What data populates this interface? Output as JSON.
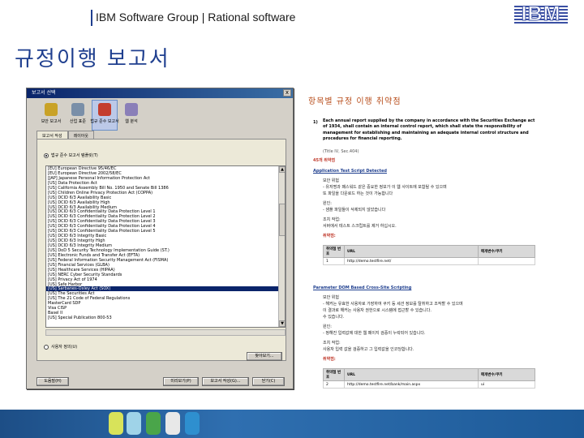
{
  "header": {
    "text": "IBM Software Group | Rational software",
    "logo": "IBM"
  },
  "slide_title": "규정이행 보고서",
  "colors": {
    "brand_blue": "#1f3f8f",
    "report_title": "#b84e1c",
    "selection": "#0a246a",
    "band": "#2f6fb0"
  },
  "dialog": {
    "title": "보고서 선택",
    "close_label": "x",
    "toolbar": [
      {
        "label": "보안 보고서",
        "icon": "lock-icon",
        "color": "#c9a227"
      },
      {
        "label": "산업 표준",
        "icon": "gear-icon",
        "color": "#7a8fa8"
      },
      {
        "label": "법규 준수 보고서",
        "icon": "compliance-icon",
        "color": "#c43d2e"
      },
      {
        "label": "웹 분석",
        "icon": "web-analysis-icon",
        "color": "#8a7fb8"
      }
    ],
    "tabs": [
      "보고서 작성",
      "레이아웃"
    ],
    "radio_top": "법규 준수 보고서 템플릿(T)",
    "list": [
      "[EU] European Directive 95/46/EC",
      "[EU] European Directive 2002/58/EC",
      "[JAP] Japanese Personal Information Protection Act",
      "[US] Data Protection Act",
      "[US] California Assembly Bill No. 1950 and Senate Bill 1386",
      "[US] Children Online Privacy Protection Act (COPPA)",
      "[US] DCID 6/3 Availability Basic",
      "[US] DCID 6/3 Availability High",
      "[US] DCID 6/3 Availability Medium",
      "[US] DCID 6/3 Confidentiality Data Protection Level 1",
      "[US] DCID 6/3 Confidentiality Data Protection Level 2",
      "[US] DCID 6/3 Confidentiality Data Protection Level 3",
      "[US] DCID 6/3 Confidentiality Data Protection Level 4",
      "[US] DCID 6/3 Confidentiality Data Protection Level 5",
      "[US] DCID 6/3 Integrity Basic",
      "[US] DCID 6/3 Integrity High",
      "[US] DCID 6/3 Integrity Medium",
      "[US] DoD 5 Security Technology Implementation Guide (ST.)",
      "[US] Electronic Funds and Transfer Act (EFTA)",
      "[US] Federal Information Security Management Act (FISMA)",
      "[US] Financial Services (GLBA)",
      "[US] Healthcare Services (HIPAA)",
      "[US] NERC Cyber Security Standards",
      "[US] Privacy Act of 1974",
      "[US] Safe Harbor",
      "[US] Sarbanes-Oxley Act (SOX)",
      "[US] The Securities Act",
      "[US] The 21 Code of Federal Regulations",
      "MasterCard SDP",
      "Visa CISP",
      "Basel II",
      "[US] Special Publication 800-53"
    ],
    "selected_index": 25,
    "radio_bottom": "사용자 정의(U)",
    "browse_label": "찾아보기...",
    "buttons": {
      "help": "도움말(H)",
      "preview": "미리보기(P)",
      "generate": "보고서 작성(G)...",
      "close": "닫기(C)"
    }
  },
  "report": {
    "title": "항목별 규정 이행 취약점",
    "section_number": "1)",
    "paragraph": "Each annual report supplied by the company in accordance with the Securities Exchange act of 1934, shall contain an internal control report, which shall state the responsibility of management for establishing and maintaining an adequate internal control structure and procedures for financial reporting.",
    "citation": "(Title IV, Sec.404)",
    "issue_count": "45개 취약점",
    "issue1": {
      "name": "Application Test Script Detected",
      "risk_label": "보안 위험",
      "risk_lines": [
        "- 유저명과 패스워드 같은 중요한 정보가 이 웹 사이트에 포함될 수 있으며",
        "또 파일을 다운로드 하는 것이 가능합니다"
      ],
      "cause_label": "원인:",
      "cause_lines": [
        "- 샘플 파일들이 삭제되지 않았습니다"
      ],
      "fix_label": "조치 작업:",
      "fix_lines": [
        "서버에서 테스트 스크립트를 제거 하십시오."
      ],
      "vuln_label": "취약점:",
      "table_headers": [
        "취약점 번호",
        "URL",
        "매개변수/쿠키"
      ],
      "rows": [
        [
          "1",
          "http://demo.testfire.net/",
          ""
        ]
      ]
    },
    "issue2": {
      "name": "Parameter DOM Based Cross-Site Scripting",
      "risk_label": "보안 위험",
      "risk_lines": [
        "- 해커는 유효한 사용자로 가장하여 쿠키 등 세션 정보를 탈취하고 조작할 수 있으며",
        "이 결과로 해커는 사용자 권한으로 시스템에 접근할 수 있습니다.",
        "수 있습니다."
      ],
      "cause_label": "원인:",
      "cause_lines": [
        "- 정해진 입력값에 대한 웹 페이지 검증이 누락되어 있습니다."
      ],
      "fix_label": "조치 작업:",
      "fix_lines": [
        "사용자 입력 값을 검증하고 그 입력값을 인코딩합니다."
      ],
      "vuln_label": "취약점:",
      "table_headers": [
        "취약점 번호",
        "URL",
        "매개변수/쿠키"
      ],
      "rows": [
        [
          "2",
          "http://demo.testfire.net/bank/main.aspx",
          "ui"
        ]
      ]
    }
  }
}
